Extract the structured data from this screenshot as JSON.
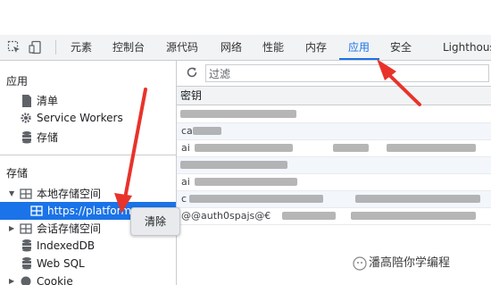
{
  "devtools_tabs": [
    "元素",
    "控制台",
    "源代码",
    "网络",
    "性能",
    "内存",
    "应用",
    "安全",
    "Lighthouse"
  ],
  "active_tab": "应用",
  "sidebar": {
    "app_section": "应用",
    "app_items": [
      "清单",
      "Service Workers",
      "存储"
    ],
    "storage_section": "存储",
    "storage_items": {
      "local_storage": "本地存储空间",
      "local_origin": "https://platform.o",
      "session_storage": "会话存储空间",
      "indexeddb": "IndexedDB",
      "websql": "Web SQL",
      "cookie": "Cookie"
    }
  },
  "context_menu": {
    "clear": "清除"
  },
  "main": {
    "filter_placeholder": "过滤",
    "column_key": "密钥",
    "rows": [
      "",
      "ca",
      "ai",
      "",
      "ai",
      "c",
      "@@auth0spajs@€"
    ]
  },
  "watermark": "潘高陪你学编程",
  "colors": {
    "accent": "#1a73e8",
    "arrow": "#e8332b"
  }
}
